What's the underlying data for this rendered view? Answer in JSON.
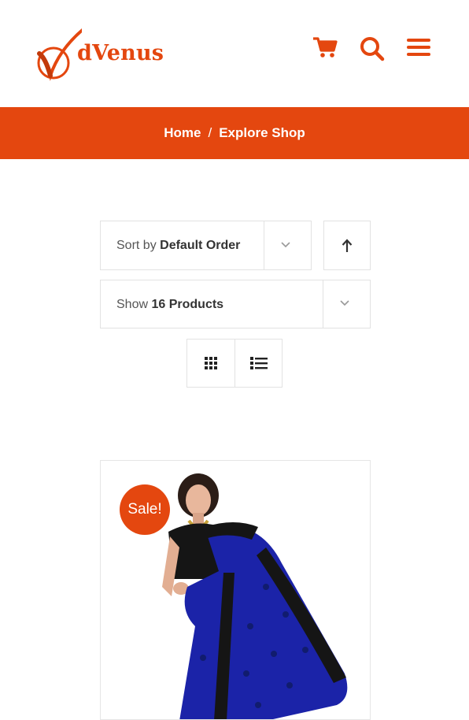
{
  "header": {
    "logo_text": "dVenus",
    "icons": [
      "cart-icon",
      "search-icon",
      "menu-icon"
    ]
  },
  "breadcrumb": {
    "home": "Home",
    "separator": "/",
    "current": "Explore Shop"
  },
  "toolbar": {
    "sort_prefix": "Sort by",
    "sort_value": "Default Order",
    "show_prefix": "Show",
    "show_value": "16 Products"
  },
  "product": {
    "badge": "Sale!"
  },
  "colors": {
    "accent": "#e4470f",
    "saree_blue": "#1b23a8",
    "border": "#e2e2e2"
  }
}
